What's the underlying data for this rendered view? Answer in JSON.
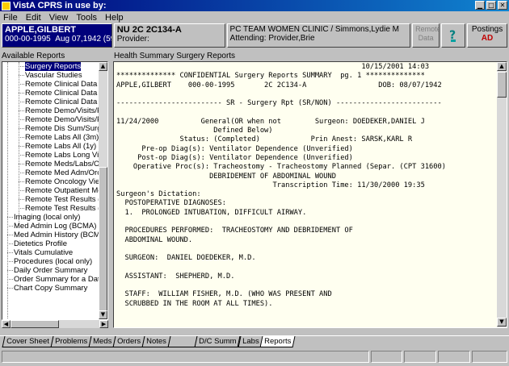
{
  "window": {
    "title": "VistA CPRS in use by:"
  },
  "menu": [
    "File",
    "Edit",
    "View",
    "Tools",
    "Help"
  ],
  "patient": {
    "name": "APPLE,GILBERT",
    "ssn": "000-00-1995",
    "dob": "Aug 07,1942 (59)"
  },
  "encounter": {
    "location": "NU 2C 2C134-A",
    "provider": "Provider:"
  },
  "team": {
    "clinic": "PC TEAM WOMEN CLINIC / Simmons,Lydie M",
    "attending": "Attending: Provider,Brie"
  },
  "remote": {
    "label1": "Remote",
    "label2": "Data"
  },
  "postings": {
    "label": "Postings",
    "value": "AD"
  },
  "left_panel": {
    "label": "Available Reports",
    "items": [
      {
        "label": "Surgery Reports",
        "level": "sub"
      },
      {
        "label": "Vascular Studies",
        "level": "sub"
      },
      {
        "label": "Remote Clinical Data (3",
        "level": "sub"
      },
      {
        "label": "Remote Clinical Data (1",
        "level": "sub"
      },
      {
        "label": "Remote Clinical Data (4",
        "level": "sub"
      },
      {
        "label": "Remote Demo/Visits/Pc",
        "level": "sub"
      },
      {
        "label": "Remote Demo/Visits/Pc",
        "level": "sub"
      },
      {
        "label": "Remote Dis Sum/Surg/P",
        "level": "sub"
      },
      {
        "label": "Remote Labs All (3m)",
        "level": "sub"
      },
      {
        "label": "Remote Labs All (1y)",
        "level": "sub"
      },
      {
        "label": "Remote Labs Long View",
        "level": "sub"
      },
      {
        "label": "Remote Meds/Labs/Ord",
        "level": "sub"
      },
      {
        "label": "Remote Med Adm/Orc",
        "level": "sub"
      },
      {
        "label": "Remote Oncology View",
        "level": "sub"
      },
      {
        "label": "Remote Outpatient Med",
        "level": "sub"
      },
      {
        "label": "Remote Test Results (6",
        "level": "sub"
      },
      {
        "label": "Remote Test Results (1",
        "level": "sub"
      },
      {
        "label": "Imaging (local only)",
        "level": "top"
      },
      {
        "label": "Med Admin Log (BCMA)",
        "level": "top"
      },
      {
        "label": "Med Admin History (BCMA",
        "level": "top"
      },
      {
        "label": "Dietetics Profile",
        "level": "top"
      },
      {
        "label": "Vitals Cumulative",
        "level": "top"
      },
      {
        "label": "Procedures (local only)",
        "level": "top"
      },
      {
        "label": "Daily Order Summary",
        "level": "top"
      },
      {
        "label": "Order Summary for a Date R",
        "level": "top"
      },
      {
        "label": "Chart Copy Summary",
        "level": "top"
      }
    ]
  },
  "report": {
    "label": "Health Summary Surgery Reports",
    "lines": [
      "                                                          10/15/2001 14:03",
      "************** CONFIDENTIAL Surgery Reports SUMMARY  pg. 1 **************",
      "APPLE,GILBERT    000-00-1995       2C 2C134-A                 DOB: 08/07/1942",
      "",
      "------------------------- SR - Surgery Rpt (SR/NON) -------------------------",
      "",
      "11/24/2000          General(OR when not        Surgeon: DOEDEKER,DANIEL J",
      "                       Defined Below)",
      "               Status: (Completed)            Prin Anest: SARSK,KARL R",
      "      Pre-op Diag(s): Ventilator Dependence (Unverified)",
      "     Post-op Diag(s): Ventilator Dependence (Unverified)",
      "    Operative Proc(s): Tracheostomy - Tracheostomy Planned (Separ. (CPT 31600)",
      "                      DEBRIDEMENT OF ABDOMINAL WOUND",
      "                                     Transcription Time: 11/30/2000 19:35",
      "Surgeon's Dictation:",
      "  POSTOPERATIVE DIAGNOSES:",
      "  1.  PROLONGED INTUBATION, DIFFICULT AIRWAY.",
      "",
      "  PROCEDURES PERFORMED:  TRACHEOSTOMY AND DEBRIDEMENT OF",
      "  ABDOMINAL WOUND.",
      "",
      "  SURGEON:  DANIEL DOEDEKER, M.D.",
      "",
      "  ASSISTANT:  SHEPHERD, M.D.",
      "",
      "  STAFF:  WILLIAM FISHER, M.D. (WHO WAS PRESENT AND",
      "  SCRUBBED IN THE ROOM AT ALL TIMES)."
    ]
  },
  "tabs": [
    "Cover Sheet",
    "Problems",
    "Meds",
    "Orders",
    "Notes",
    "",
    "D/C Summ",
    "Labs",
    "Reports"
  ],
  "active_tab": "Reports"
}
